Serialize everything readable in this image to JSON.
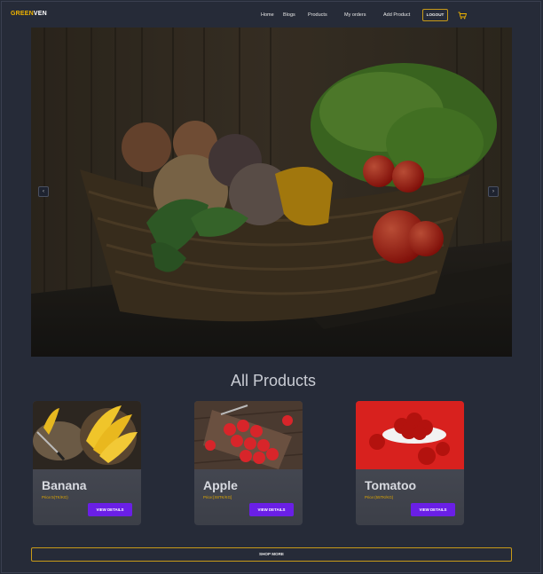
{
  "brand": {
    "part1": "GREEN",
    "part2": "VEN"
  },
  "nav": {
    "links": [
      "Home",
      "Blogs",
      "Products",
      "My orders",
      "Add Product"
    ],
    "logout_label": "LOGOUT",
    "cart_icon": "cart-icon"
  },
  "carousel": {
    "prev_icon": "chevron-left-icon",
    "next_icon": "chevron-right-icon",
    "prev_glyph": "‹",
    "next_glyph": "›"
  },
  "products": {
    "title": "All Products",
    "items": [
      {
        "name": "Banana",
        "price": "Price:5(TK/KG)",
        "button": "VIEW DETAILS"
      },
      {
        "name": "Apple",
        "price": "Price:[X8TK/KG]",
        "button": "VIEW DETAILS"
      },
      {
        "name": "Tomatoo",
        "price": "Price:(55TK/KG)",
        "button": "VIEW DETAILS"
      }
    ]
  },
  "shop_more_label": "SHOP MORE",
  "colors": {
    "background": "#262b38",
    "brand_accent": "#f0b400",
    "button_purple": "#6a1fe6",
    "outline_gold": "#c89a18"
  }
}
